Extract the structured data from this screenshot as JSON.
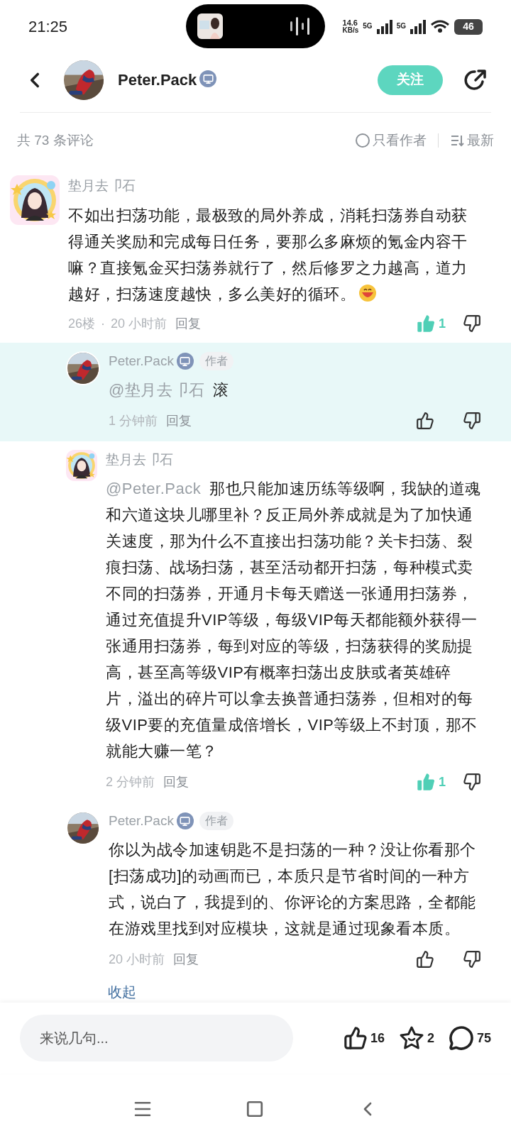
{
  "status_bar": {
    "time": "21:25",
    "net_speed": "14.6",
    "net_unit": "KB/s",
    "sim_1": "5G",
    "sim_2": "5G",
    "battery": "46"
  },
  "header": {
    "username": "Peter.Pack",
    "follow": "关注"
  },
  "comment_bar": {
    "count": "共 73 条评论",
    "author_only": {
      "label": "只看作者",
      "checked": false
    },
    "sort": "最新"
  },
  "comment": {
    "author": "垫月去卩石",
    "text": "不如出扫荡功能，最极致的局外养成，消耗扫荡券自动获得通关奖励和完成每日任务，要那么多麻烦的氪金内容干嘛？直接氪金买扫荡券就行了，然后修罗之力越高，道力越好，扫荡速度越快，多么美好的循环。",
    "floor": "26楼",
    "separator": "·",
    "time": "20 小时前",
    "reply": "回复",
    "like_count": "1",
    "liked": true
  },
  "replies": [
    {
      "kind": "author",
      "author": "Peter.Pack",
      "badge": "作者",
      "highlighted": true,
      "mention": "@垫月去卩石",
      "text": "滚",
      "time": "1 分钟前",
      "reply": "回复",
      "liked": false
    },
    {
      "kind": "user",
      "author": "垫月去卩石",
      "highlighted": false,
      "mention": "@Peter.Pack",
      "text": "那也只能加速历练等级啊，我缺的道魂和六道这块儿哪里补？反正局外养成就是为了加快通关速度，那为什么不直接出扫荡功能？关卡扫荡、裂痕扫荡、战场扫荡，甚至活动都开扫荡，每种模式卖不同的扫荡券，开通月卡每天赠送一张通用扫荡券，通过充值提升VIP等级，每级VIP每天都能额外获得一张通用扫荡券，每到对应的等级，扫荡获得的奖励提高，甚至高等级VIP有概率扫荡出皮肤或者英雄碎片，溢出的碎片可以拿去换普通扫荡券，但相对的每级VIP要的充值量成倍增长，VIP等级上不封顶，那不就能大赚一笔？",
      "time": "2 分钟前",
      "reply": "回复",
      "like_count": "1",
      "liked": true
    },
    {
      "kind": "author",
      "author": "Peter.Pack",
      "badge": "作者",
      "highlighted": false,
      "text": "你以为战令加速钥匙不是扫荡的一种？没让你看那个[扫荡成功]的动画而已，本质只是节省时间的一种方式，说白了，我提到的、你评论的方案思路，全都能在游戏里找到对应模块，这就是通过现象看本质。",
      "time": "20 小时前",
      "reply": "回复",
      "liked": false
    }
  ],
  "collapse": "收起",
  "bottom_bar": {
    "placeholder": "来说几句...",
    "likes": "16",
    "favorites": "2",
    "comments": "75"
  }
}
